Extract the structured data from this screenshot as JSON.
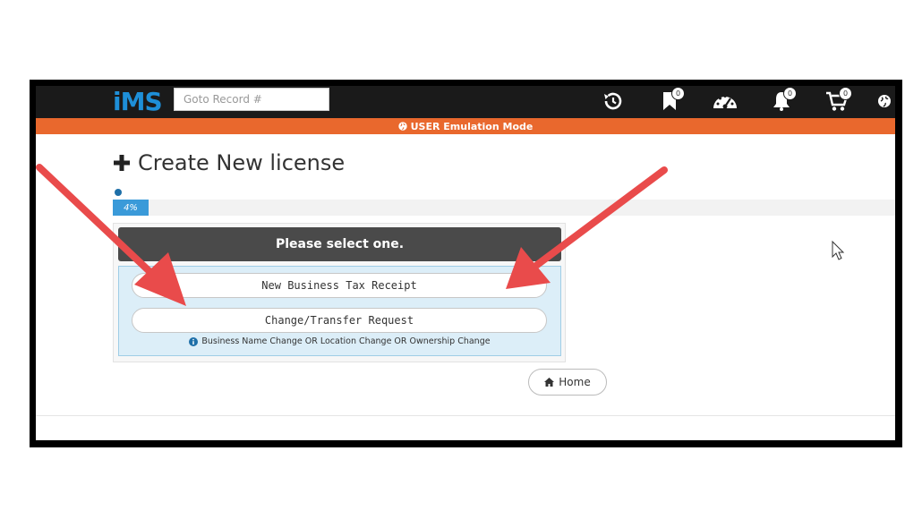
{
  "app": {
    "logo_text": "iMS",
    "brand_color": "#1e8fd8"
  },
  "topbar": {
    "search_placeholder": "Goto Record #",
    "icons": [
      {
        "name": "history-icon",
        "badge": ""
      },
      {
        "name": "bookmark-icon",
        "badge": "0"
      },
      {
        "name": "dashboard-icon",
        "badge": ""
      },
      {
        "name": "bell-icon",
        "badge": "0"
      },
      {
        "name": "cart-icon",
        "badge": "0"
      },
      {
        "name": "globe-icon",
        "badge": ""
      }
    ]
  },
  "emulation_bar": {
    "text": "USER Emulation Mode",
    "color": "#e9682d"
  },
  "page": {
    "title": "Create New license"
  },
  "progress": {
    "label": "4%",
    "value_percent": 4
  },
  "panel": {
    "heading": "Please select one.",
    "options": [
      {
        "label": "New Business Tax Receipt"
      },
      {
        "label": "Change/Transfer Request"
      }
    ],
    "note": "Business Name Change OR Location Change OR Ownership Change"
  },
  "footer": {
    "home_label": "Home"
  },
  "annotations": {
    "arrow_color": "#e94b4b"
  }
}
